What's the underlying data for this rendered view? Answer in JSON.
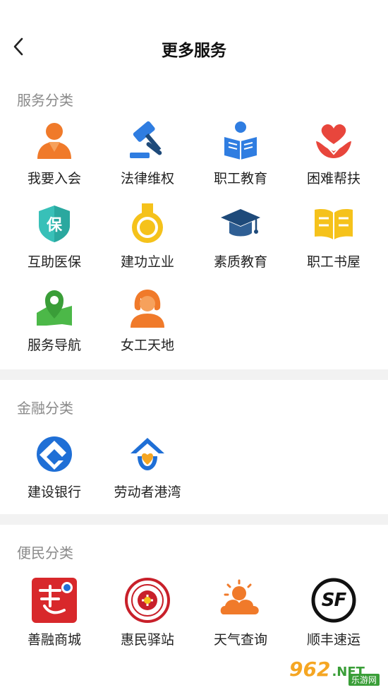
{
  "header": {
    "title": "更多服务"
  },
  "sections": [
    {
      "title": "服务分类",
      "items": [
        {
          "label": "我要入会",
          "icon": "person-join-icon"
        },
        {
          "label": "法律维权",
          "icon": "gavel-icon"
        },
        {
          "label": "职工教育",
          "icon": "reading-person-icon"
        },
        {
          "label": "困难帮扶",
          "icon": "heart-hand-icon"
        },
        {
          "label": "互助医保",
          "icon": "insurance-shield-icon",
          "glyph": "保"
        },
        {
          "label": "建功立业",
          "icon": "medal-icon"
        },
        {
          "label": "素质教育",
          "icon": "graduation-cap-icon"
        },
        {
          "label": "职工书屋",
          "icon": "book-icon"
        },
        {
          "label": "服务导航",
          "icon": "map-pin-icon"
        },
        {
          "label": "女工天地",
          "icon": "woman-icon"
        }
      ]
    },
    {
      "title": "金融分类",
      "items": [
        {
          "label": "建设银行",
          "icon": "ccb-bank-icon"
        },
        {
          "label": "劳动者港湾",
          "icon": "worker-harbor-icon"
        }
      ]
    },
    {
      "title": "便民分类",
      "items": [
        {
          "label": "善融商城",
          "icon": "shanrong-mall-icon"
        },
        {
          "label": "惠民驿站",
          "icon": "huimin-station-icon"
        },
        {
          "label": "天气查询",
          "icon": "weather-icon"
        },
        {
          "label": "顺丰速运",
          "icon": "sf-express-icon",
          "glyph": "SF"
        }
      ]
    }
  ],
  "watermark": {
    "number": "962",
    "suffix": ".NET",
    "sub": "乐游网"
  },
  "colors": {
    "orange": "#f07a2a",
    "blue": "#2f7de1",
    "red": "#e8463c",
    "teal": "#38c0b8",
    "yellow": "#f5c21b",
    "navy": "#1e4a7a",
    "green": "#4cb848"
  }
}
